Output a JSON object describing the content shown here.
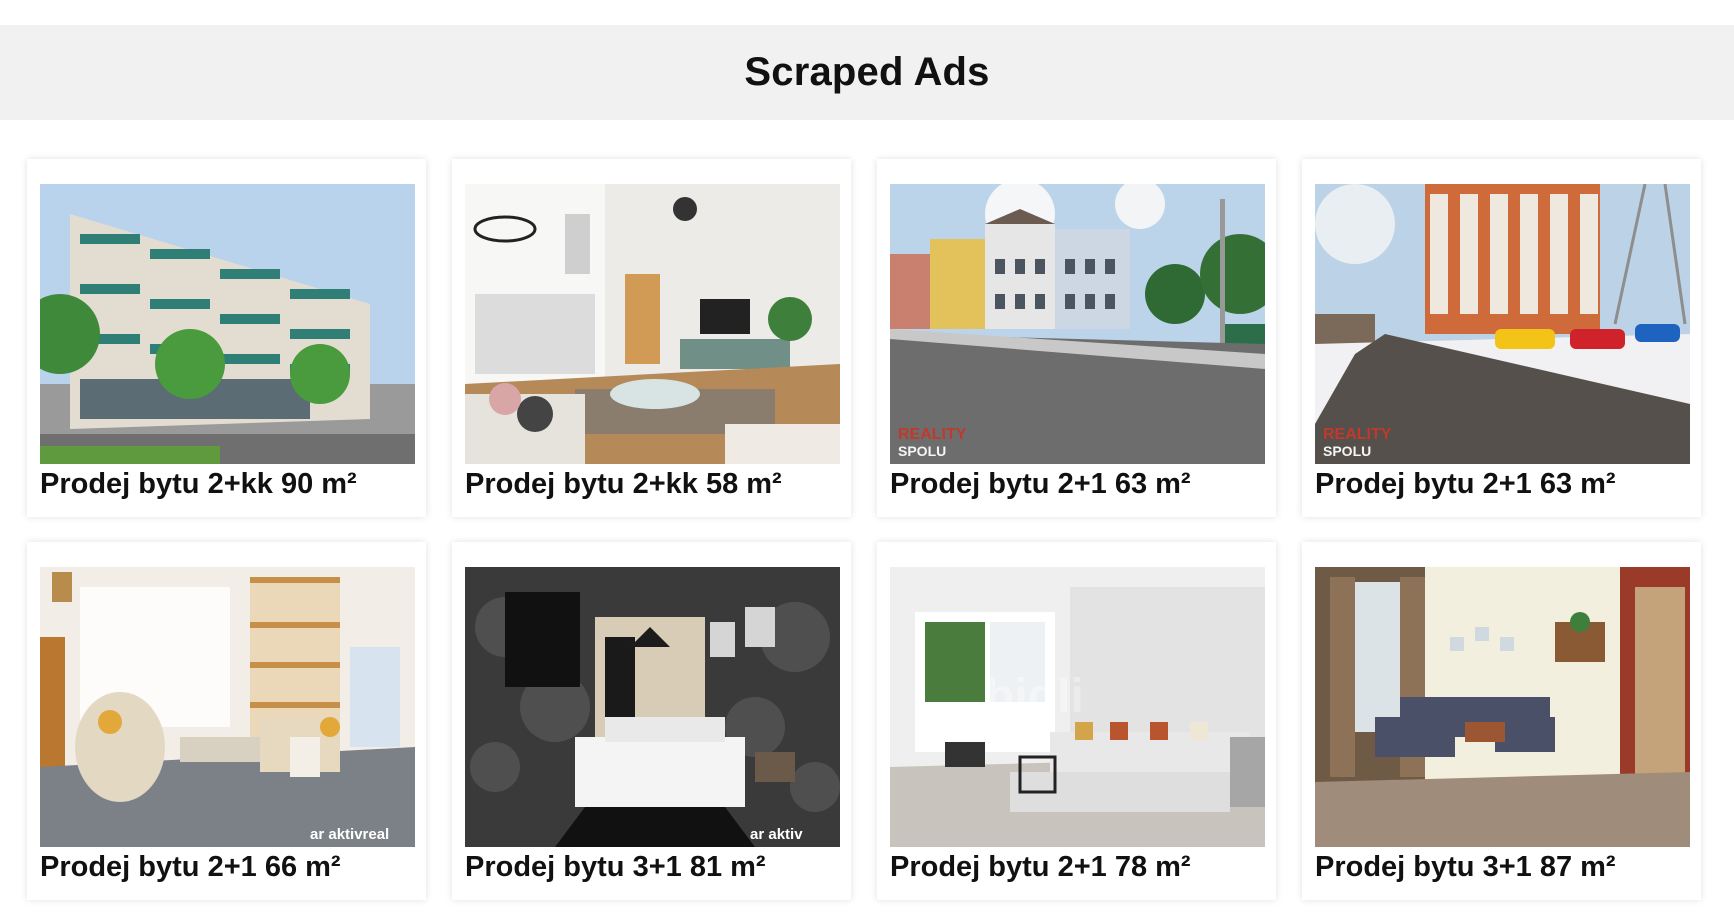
{
  "page": {
    "title": "Scraped Ads"
  },
  "ads": [
    {
      "title": "Prodej bytu 2+kk 90 m²",
      "image_alt": "modern apartment building exterior",
      "watermark": ""
    },
    {
      "title": "Prodej bytu 2+kk 58 m²",
      "image_alt": "living room with kitchen and tv",
      "watermark": ""
    },
    {
      "title": "Prodej bytu 2+1 63 m²",
      "image_alt": "street with houses",
      "watermark": "REALITY SPOLU"
    },
    {
      "title": "Prodej bytu 2+1 63 m²",
      "image_alt": "snowy street with panel building",
      "watermark": "REALITY SPOLU"
    },
    {
      "title": "Prodej bytu 2+1 66 m²",
      "image_alt": "retro living room with armchairs",
      "watermark": "aktivreal"
    },
    {
      "title": "Prodej bytu 3+1 81 m²",
      "image_alt": "dark bedroom with floral wallpaper",
      "watermark": "aktivreal"
    },
    {
      "title": "Prodej bytu 2+1 78 m²",
      "image_alt": "white living room with sofa",
      "watermark": "bidli"
    },
    {
      "title": "Prodej bytu 3+1 87 m²",
      "image_alt": "living room with blue sofa",
      "watermark": ""
    }
  ],
  "colors": {
    "header_bg": "#f1f1f1",
    "card_bg": "#ffffff",
    "text": "#111111"
  }
}
